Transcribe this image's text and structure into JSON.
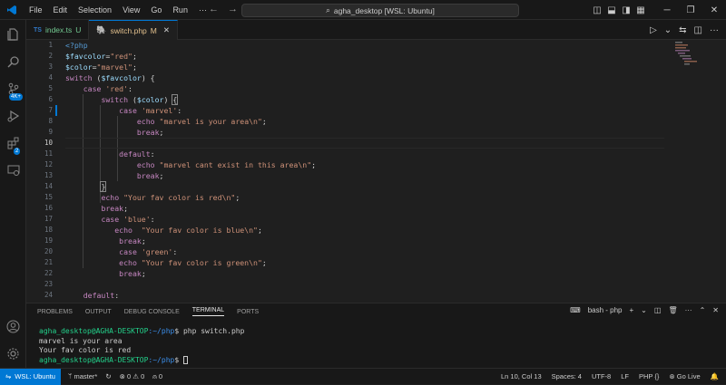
{
  "menu": [
    "File",
    "Edit",
    "Selection",
    "View",
    "Go",
    "Run",
    "···"
  ],
  "command_center": "agha_desktop [WSL: Ubuntu]",
  "tabs": [
    {
      "label": "index.ts",
      "status": "U",
      "lang": "TS"
    },
    {
      "label": "switch.php",
      "status": "M"
    }
  ],
  "line_numbers": [
    "1",
    "2",
    "3",
    "4",
    "5",
    "6",
    "7",
    "8",
    "9",
    "10",
    "11",
    "12",
    "13",
    "14",
    "15",
    "16",
    "17",
    "18",
    "19",
    "20",
    "21",
    "22",
    "23",
    "24",
    "25"
  ],
  "panel": {
    "tabs": [
      "PROBLEMS",
      "OUTPUT",
      "DEBUG CONSOLE",
      "TERMINAL",
      "PORTS"
    ],
    "terminal_label": "bash - php",
    "prompt_user": "agha_desktop@AGHA-DESKTOP",
    "prompt_path": ":~/php",
    "command": "$ php switch.php",
    "output1": "marvel is your area",
    "output2": "Your fav color is red",
    "prompt_end": "$ "
  },
  "statusbar": {
    "remote": "WSL: Ubuntu",
    "branch": "master*",
    "errors": "0",
    "warnings": "0",
    "ports": "0",
    "position": "Ln 10, Col 13",
    "spaces": "Spaces: 4",
    "encoding": "UTF-8",
    "eol": "LF",
    "language": "PHP",
    "golive": "Go Live"
  },
  "badges": {
    "scm": "4K+",
    "extensions": "2"
  },
  "colors": {
    "accent": "#0078d4",
    "keyword": "#c586c0",
    "variable": "#9cdcfe",
    "string": "#ce9178"
  }
}
